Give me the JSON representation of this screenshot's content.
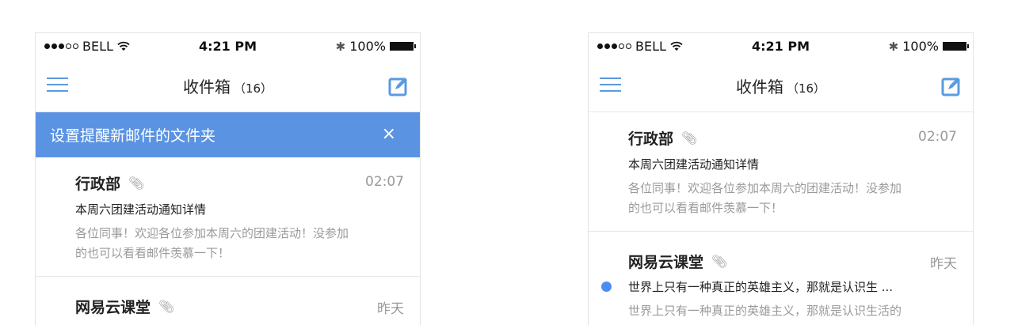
{
  "status_bar": {
    "carrier": "BELL",
    "time": "4:21 PM",
    "battery": "100%"
  },
  "header": {
    "title": "收件箱",
    "count": "（16）"
  },
  "banner": {
    "text": "设置提醒新邮件的文件夹",
    "close": "×"
  },
  "mails": [
    {
      "sender": "行政部",
      "time": "02:07",
      "subject": "本周六团建活动通知详情",
      "preview_line1": "各位同事！欢迎各位参加本周六的团建活动！没参加",
      "preview_line2": "的也可以看看邮件羡慕一下！"
    },
    {
      "sender": "网易云课堂",
      "time": "昨天",
      "subject": "世界上只有一种真正的英雄主义，那就是认识生 ...",
      "preview_line1": "世界上只有一种真正的英雄主义，那就是认识生活的"
    }
  ],
  "icons": {
    "menu": "menu-icon",
    "compose": "compose-icon",
    "attachment": "paperclip-icon",
    "bluetooth": "bluetooth-icon",
    "wifi": "wifi-icon",
    "battery": "battery-icon"
  },
  "colors": {
    "accent": "#5a93e2",
    "unread": "#4a8ff0"
  }
}
